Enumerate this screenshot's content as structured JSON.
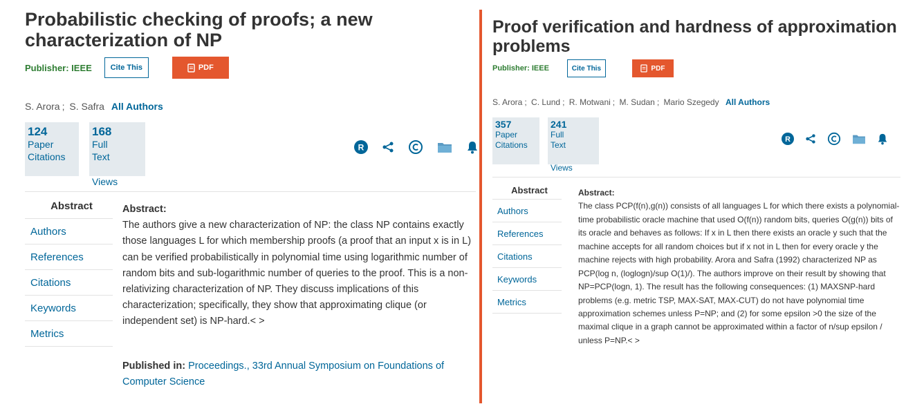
{
  "left": {
    "title": "Probabilistic checking of proofs; a new characterization of NP",
    "publisher": "Publisher: IEEE",
    "cite_label": "Cite This",
    "pdf_label": "PDF",
    "authors": [
      "S. Arora",
      "S. Safra"
    ],
    "all_authors_label": "All Authors",
    "metrics": {
      "paper_citations": "124",
      "paper_label_1": "Paper",
      "paper_label_2": "Citations",
      "full_text_views": "168",
      "full_label_1": "Full",
      "full_label_2": "Text",
      "full_label_3": "Views"
    },
    "nav": [
      "Abstract",
      "Authors",
      "References",
      "Citations",
      "Keywords",
      "Metrics"
    ],
    "abstract_heading": "Abstract:",
    "abstract_text": "The authors give a new characterization of NP: the class NP contains exactly those languages L for which membership proofs (a proof that an input x is in L) can be verified probabilistically in polynomial time using logarithmic number of random bits and sub-logarithmic number of queries to the proof. This is a non-relativizing characterization of NP. They discuss implications of this characterization; specifically, they show that approximating clique (or independent set) is NP-hard.< >",
    "published_label": "Published in:",
    "published_in": "Proceedings., 33rd Annual Symposium on Foundations of Computer Science"
  },
  "right": {
    "title": "Proof verification and hardness of approximation problems",
    "publisher": "Publisher: IEEE",
    "cite_label": "Cite This",
    "pdf_label": "PDF",
    "authors": [
      "S. Arora",
      "C. Lund",
      "R. Motwani",
      "M. Sudan",
      "Mario Szegedy"
    ],
    "all_authors_label": "All Authors",
    "metrics": {
      "paper_citations": "357",
      "paper_label_1": "Paper",
      "paper_label_2": "Citations",
      "full_text_views": "241",
      "full_label_1": "Full",
      "full_label_2": "Text",
      "full_label_3": "Views"
    },
    "nav": [
      "Abstract",
      "Authors",
      "References",
      "Citations",
      "Keywords",
      "Metrics"
    ],
    "abstract_heading": "Abstract:",
    "abstract_text": "The class PCP(f(n),g(n)) consists of all languages L for which there exists a polynomial-time probabilistic oracle machine that used O(f(n)) random bits, queries O(g(n)) bits of its oracle and behaves as follows: If x in L then there exists an oracle y such that the machine accepts for all random choices but if x not in L then for every oracle y the machine rejects with high probability. Arora and Safra (1992) characterized NP as PCP(log n, (loglogn)/sup O(1)/). The authors improve on their result by showing that NP=PCP(logn, 1). The result has the following consequences: (1) MAXSNP-hard problems (e.g. metric TSP, MAX-SAT, MAX-CUT) do not have polynomial time approximation schemes unless P=NP; and (2) for some epsilon >0 the size of the maximal clique in a graph cannot be approximated within a factor of n/sup epsilon / unless P=NP.< >"
  },
  "icons": [
    "reddit-icon",
    "share-icon",
    "copyright-icon",
    "folder-icon",
    "bell-icon",
    "pdf-file-icon"
  ],
  "colors": {
    "accent": "#006699",
    "pdf": "#e4572e",
    "publisher": "#2e7d32",
    "metric_bg": "#e4eaee",
    "divider": "#e4572e"
  }
}
